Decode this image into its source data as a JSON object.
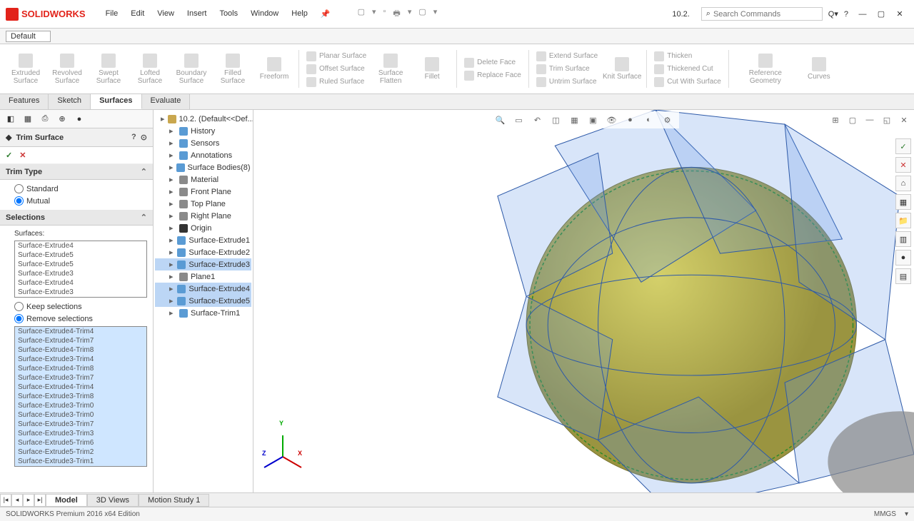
{
  "app": {
    "logo_text": "SOLIDWORKS",
    "doc_name": "10.2.",
    "search_placeholder": "Search Commands"
  },
  "menu": [
    "File",
    "Edit",
    "View",
    "Insert",
    "Tools",
    "Window",
    "Help"
  ],
  "config": {
    "name": "Default"
  },
  "ribbon": {
    "buttons": [
      {
        "label": "Extruded Surface"
      },
      {
        "label": "Revolved Surface"
      },
      {
        "label": "Swept Surface"
      },
      {
        "label": "Lofted Surface"
      },
      {
        "label": "Boundary Surface"
      },
      {
        "label": "Filled Surface"
      },
      {
        "label": "Freeform"
      }
    ],
    "stack1": [
      "Planar Surface",
      "Offset Surface",
      "Ruled Surface"
    ],
    "stack2": [
      "Surface Flatten"
    ],
    "fillet": "Fillet",
    "stack3": [
      "Delete Face",
      "Replace Face"
    ],
    "stack4": [
      "Extend Surface",
      "Trim Surface",
      "Untrim Surface"
    ],
    "knit": "Knit Surface",
    "stack5": [
      "Thicken",
      "Thickened Cut",
      "Cut With Surface"
    ],
    "ref": "Reference Geometry",
    "curves": "Curves"
  },
  "tabs": [
    "Features",
    "Sketch",
    "Surfaces",
    "Evaluate"
  ],
  "active_tab": "Surfaces",
  "property_panel": {
    "title": "Trim Surface",
    "trim_type_label": "Trim Type",
    "trim_options": {
      "standard": "Standard",
      "mutual": "Mutual"
    },
    "selections_label": "Selections",
    "surfaces_label": "Surfaces:",
    "surfaces_list": [
      "Surface-Extrude4",
      "Surface-Extrude5",
      "Surface-Extrude5",
      "Surface-Extrude3",
      "Surface-Extrude4",
      "Surface-Extrude3"
    ],
    "keep_label": "Keep selections",
    "remove_label": "Remove selections",
    "remove_list": [
      "Surface-Extrude4-Trim4",
      "Surface-Extrude4-Trim7",
      "Surface-Extrude4-Trim8",
      "Surface-Extrude3-Trim4",
      "Surface-Extrude4-Trim8",
      "Surface-Extrude3-Trim7",
      "Surface-Extrude4-Trim4",
      "Surface-Extrude3-Trim8",
      "Surface-Extrude3-Trim0",
      "Surface-Extrude3-Trim0",
      "Surface-Extrude3-Trim7",
      "Surface-Extrude3-Trim3",
      "Surface-Extrude5-Trim6",
      "Surface-Extrude5-Trim2",
      "Surface-Extrude3-Trim1"
    ]
  },
  "tree": {
    "root": "10.2. (Default<<Def...",
    "items": [
      {
        "label": "History",
        "icon": "surf"
      },
      {
        "label": "Sensors",
        "icon": "surf"
      },
      {
        "label": "Annotations",
        "icon": "surf"
      },
      {
        "label": "Surface Bodies(8)",
        "icon": "surf"
      },
      {
        "label": "Material <not sp...",
        "icon": "plane"
      },
      {
        "label": "Front Plane",
        "icon": "plane"
      },
      {
        "label": "Top Plane",
        "icon": "plane"
      },
      {
        "label": "Right Plane",
        "icon": "plane"
      },
      {
        "label": "Origin",
        "icon": "origin"
      },
      {
        "label": "Surface-Extrude1",
        "icon": "surf"
      },
      {
        "label": "Surface-Extrude2",
        "icon": "surf"
      },
      {
        "label": "Surface-Extrude3",
        "icon": "surf",
        "sel": true
      },
      {
        "label": "Plane1",
        "icon": "plane"
      },
      {
        "label": "Surface-Extrude4",
        "icon": "surf",
        "sel": true
      },
      {
        "label": "Surface-Extrude5",
        "icon": "surf",
        "sel": true
      },
      {
        "label": "Surface-Trim1",
        "icon": "surf"
      }
    ]
  },
  "bottom_tabs": [
    "Model",
    "3D Views",
    "Motion Study 1"
  ],
  "active_bottom_tab": "Model",
  "statusbar": {
    "edition": "SOLIDWORKS Premium 2016 x64 Edition",
    "units": "MMGS"
  },
  "triad": {
    "x": "X",
    "y": "Y",
    "z": "Z"
  }
}
